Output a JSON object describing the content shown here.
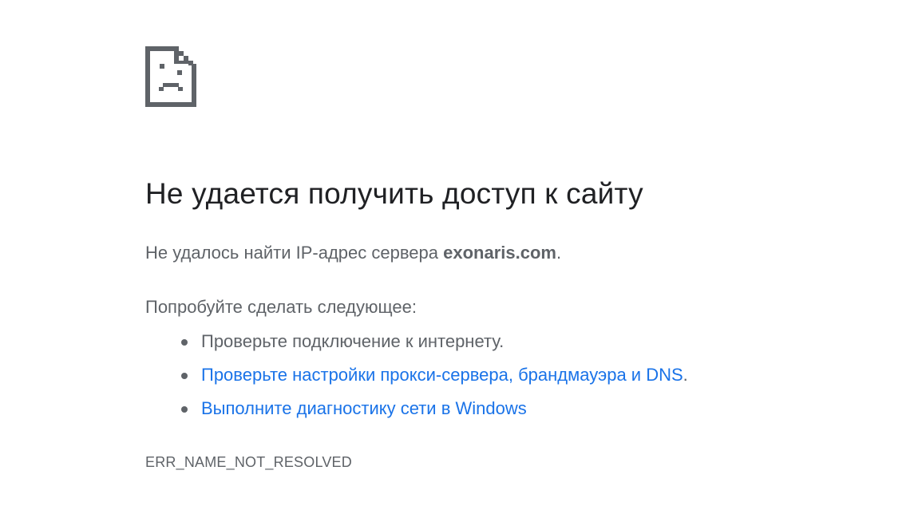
{
  "page": {
    "icon": "sad-page-icon",
    "title": "Не удается получить доступ к сайту",
    "message_prefix": "Не удалось найти IP-адрес сервера ",
    "host": "exonaris.com",
    "message_suffix": ".",
    "suggestions_heading": "Попробуйте сделать следующее:",
    "suggestions": [
      {
        "text": "Проверьте подключение к интернету.",
        "link": false
      },
      {
        "text": "Проверьте настройки прокси-сервера, брандмауэра и DNS",
        "suffix": ".",
        "link": true
      },
      {
        "text": "Выполните диагностику сети в Windows",
        "link": true
      }
    ],
    "error_code": "ERR_NAME_NOT_RESOLVED"
  },
  "colors": {
    "title": "#202124",
    "text": "#5f6368",
    "link": "#1a73e8",
    "icon": "#5f6368"
  }
}
